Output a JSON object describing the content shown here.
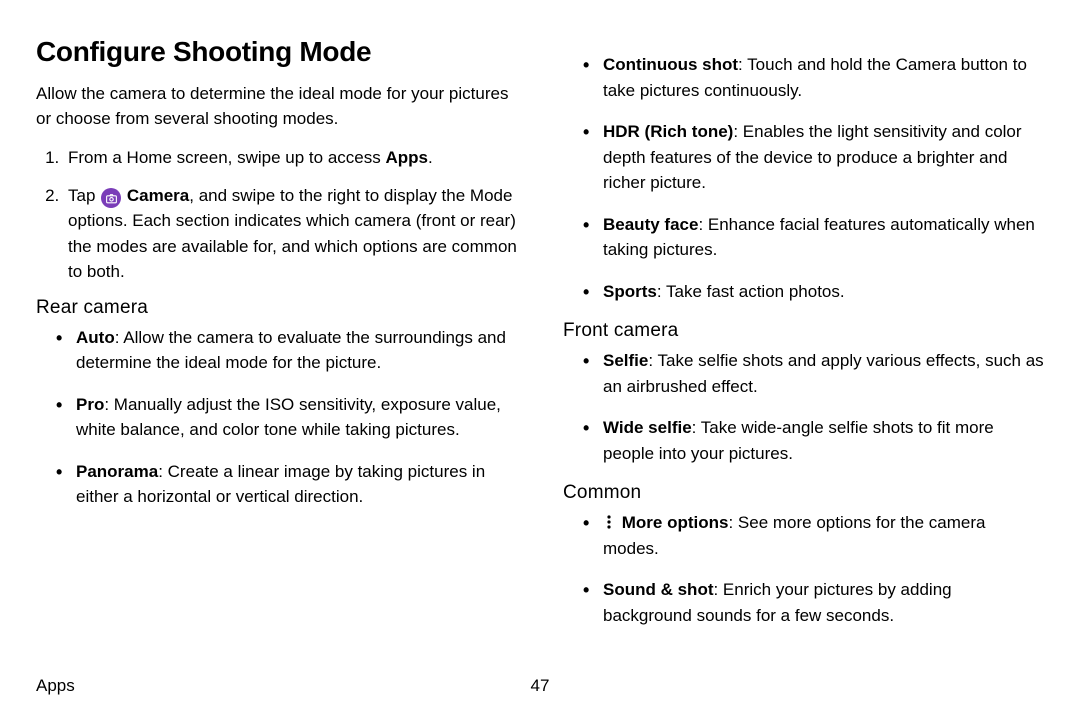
{
  "title": "Configure Shooting Mode",
  "intro": "Allow the camera to determine the ideal mode for your pictures or choose from several shooting modes.",
  "steps": {
    "s1_pre": "From a Home screen, swipe up to access ",
    "s1_bold": "Apps",
    "s1_post": ".",
    "s2_pre": "Tap ",
    "s2_bold": "Camera",
    "s2_post": ", and swipe to the right to display the Mode options. Each section indicates which camera (front or rear) the modes are available for, and which options are common to both."
  },
  "rear": {
    "heading": "Rear camera",
    "items": {
      "auto": {
        "label": "Auto",
        "desc": ": Allow the camera to evaluate the surroundings and determine the ideal mode for the picture."
      },
      "pro": {
        "label": "Pro",
        "desc": ": Manually adjust the ISO sensitivity, exposure value, white balance, and color tone while taking pictures."
      },
      "panorama": {
        "label": "Panorama",
        "desc": ": Create a linear image by taking pictures in either a horizontal or vertical direction."
      },
      "continuous": {
        "label": "Continuous shot",
        "desc": ": Touch and hold the Camera button to take pictures continuously."
      },
      "hdr": {
        "label": "HDR (Rich tone)",
        "desc": ": Enables the light sensitivity and color depth features of the device to produce a brighter and richer picture."
      },
      "beauty": {
        "label": "Beauty face",
        "desc": ": Enhance facial features automatically when taking pictures."
      },
      "sports": {
        "label": "Sports",
        "desc": ": Take fast action photos."
      }
    }
  },
  "front": {
    "heading": "Front camera",
    "items": {
      "selfie": {
        "label": "Selfie",
        "desc": ": Take selfie shots and apply various effects, such as an airbrushed effect."
      },
      "wide": {
        "label": "Wide selfie",
        "desc": ": Take wide-angle selfie shots to fit more people into your pictures."
      }
    }
  },
  "common": {
    "heading": "Common",
    "items": {
      "more": {
        "label": "More options",
        "desc": ": See more options for the camera modes."
      },
      "sound": {
        "label": "Sound & shot",
        "desc": ": Enrich your pictures by adding background sounds for a few seconds."
      }
    }
  },
  "footer": {
    "section": "Apps",
    "page": "47"
  }
}
